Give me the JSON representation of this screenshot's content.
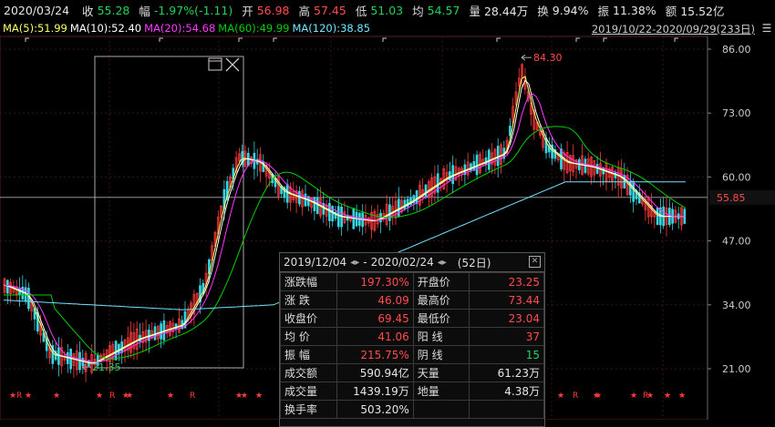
{
  "header": {
    "date": "2020/03/24",
    "close_label": "收",
    "close_val": "55.28",
    "chg_label": "幅",
    "chg_val": "-1.97%(-1.11)",
    "open_label": "开",
    "open_val": "56.98",
    "high_label": "高",
    "high_val": "57.45",
    "low_label": "低",
    "low_val": "51.03",
    "avg_label": "均",
    "avg_val": "54.57",
    "vol_label": "量",
    "vol_val": "28.44万",
    "turn_label": "换",
    "turn_val": "9.94%",
    "amp_label": "振",
    "amp_val": "11.38%",
    "amt_label": "额",
    "amt_val": "15.52亿",
    "range": "2019/10/22-2020/09/29(233日)"
  },
  "ma": {
    "ma5": "MA(5):51.99",
    "ma10": "MA(10):52.40",
    "ma20": "MA(20):54.68",
    "ma60": "MA(60):49.99",
    "ma120": "MA(120):38.85"
  },
  "y_axis": {
    "ticks": [
      "86.00",
      "73.00",
      "60.00",
      "47.00",
      "34.00",
      "21.00"
    ],
    "current": "55.85"
  },
  "annotations": {
    "high_mark": "84.30",
    "low_mark": "21.35"
  },
  "colors": {
    "up": "#ff3b3b",
    "down": "#36d3e0",
    "ma5": "#ffff66",
    "ma10": "#ffffff",
    "ma20": "#ff38ff",
    "ma60": "#00d000",
    "ma120": "#6fe6ff"
  },
  "panel": {
    "start": "2019/12/04",
    "sep": "-",
    "end": "2020/02/24",
    "count": "(52日)",
    "rows": [
      {
        "l1": "涨跌幅",
        "v1": "197.30%",
        "c1": "red",
        "l2": "开盘价",
        "v2": "23.25",
        "c2": "red"
      },
      {
        "l1": "涨  跌",
        "v1": "46.09",
        "c1": "red",
        "l2": "最高价",
        "v2": "73.44",
        "c2": "red"
      },
      {
        "l1": "收盘价",
        "v1": "69.45",
        "c1": "red",
        "l2": "最低价",
        "v2": "23.04",
        "c2": "red"
      },
      {
        "l1": "均  价",
        "v1": "41.06",
        "c1": "red",
        "l2": "阳  线",
        "v2": "37",
        "c2": "red"
      },
      {
        "l1": "振  幅",
        "v1": "215.75%",
        "c1": "red",
        "l2": "阴  线",
        "v2": "15",
        "c2": "grn"
      },
      {
        "l1": "成交额",
        "v1": "590.94亿",
        "c1": "wht",
        "l2": "天量",
        "v2": "61.23万",
        "c2": "wht"
      },
      {
        "l1": "成交量",
        "v1": "1439.19万",
        "c1": "wht",
        "l2": "地量",
        "v2": "4.38万",
        "c2": "wht"
      },
      {
        "l1": "换手率",
        "v1": "503.20%",
        "c1": "wht",
        "l2": "",
        "v2": "",
        "c2": "wht"
      }
    ]
  }
}
